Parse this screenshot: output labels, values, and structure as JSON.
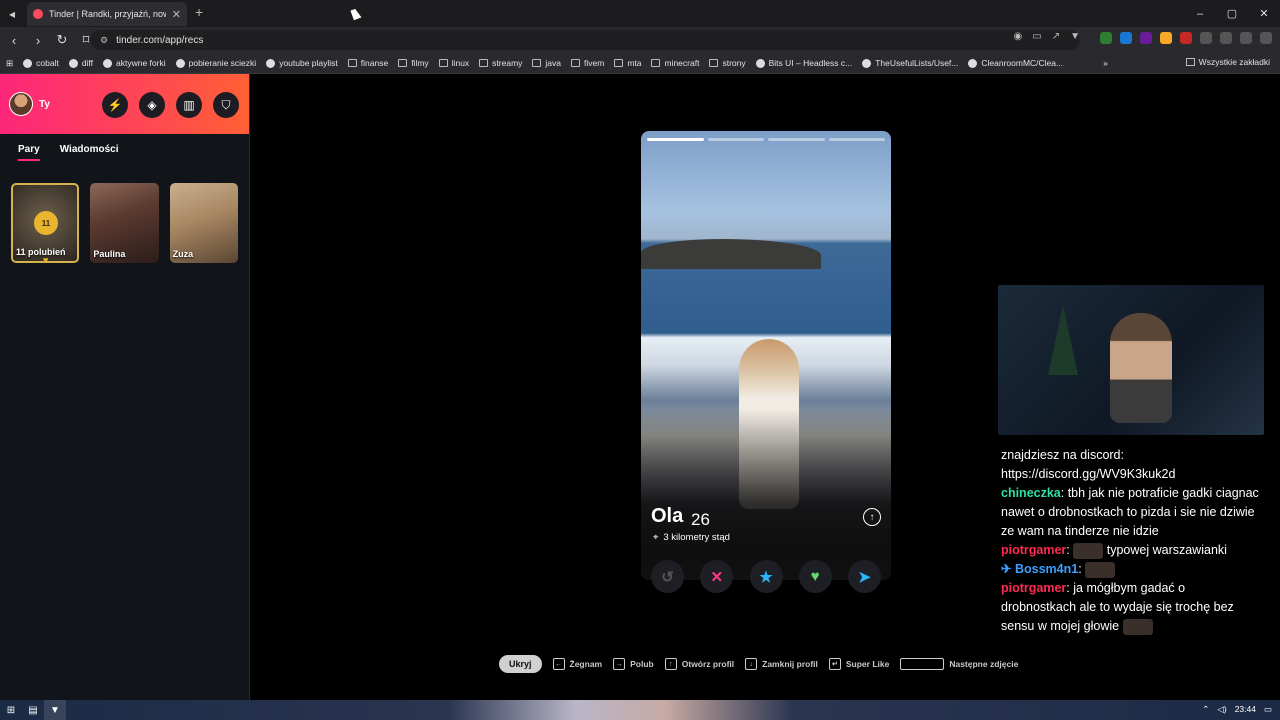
{
  "browser": {
    "tab_title": "Tinder | Randki, przyjaźń, nowe z",
    "tab_close": "✕",
    "new_tab": "+",
    "url": "tinder.com/app/recs",
    "bookmarks": [
      "cobalt",
      "diff",
      "aktywne forki",
      "pobieranie sciezki",
      "youtube playlist",
      "finanse",
      "filmy",
      "linux",
      "streamy",
      "java",
      "fivem",
      "mta",
      "minecraft",
      "strony",
      "Bits UI – Headless c...",
      "TheUsefulLists/Usef...",
      "CleanroomMC/Clea..."
    ],
    "bookmarks_overflow": "»",
    "all_bookmarks": "Wszystkie zakładki",
    "window_controls": [
      "–",
      "▢",
      "✕"
    ]
  },
  "sidebar": {
    "user_label": "Ty",
    "tabs": [
      "Pary",
      "Wiadomości"
    ],
    "matches": [
      {
        "name": "11 polubień",
        "badge": "11"
      },
      {
        "name": "Paulina"
      },
      {
        "name": "Zuza"
      }
    ]
  },
  "profile": {
    "name": "Ola",
    "age": "26",
    "distance": "3 kilometry stąd"
  },
  "hints": {
    "hide": "Ukryj",
    "items": [
      {
        "label": "Żegnam"
      },
      {
        "label": "Polub"
      },
      {
        "label": "Otwórz profil"
      },
      {
        "label": "Zamknij profil"
      },
      {
        "label": "Super Like"
      },
      {
        "label": "Następne zdjęcie"
      }
    ]
  },
  "chat": {
    "line0": "znajdziesz na discord: https://discord.gg/WV9K3kuk2d",
    "m1_user": "chineczka",
    "m1_text": ": tbh jak nie potraficie gadki ciagnac nawet o drobnostkach to pizda i sie nie dziwie ze wam na tinderze nie idzie",
    "m2_user": "piotrgamer",
    "m2_text": "typowej warszawianki",
    "m3_user": "Bossm4n1",
    "m4_user": "piotrgamer",
    "m4_text": ": ja mógłbym gadać o drobnostkach ale to wydaje się trochę bez sensu w mojej głowie"
  },
  "taskbar": {
    "time": "23:44"
  }
}
